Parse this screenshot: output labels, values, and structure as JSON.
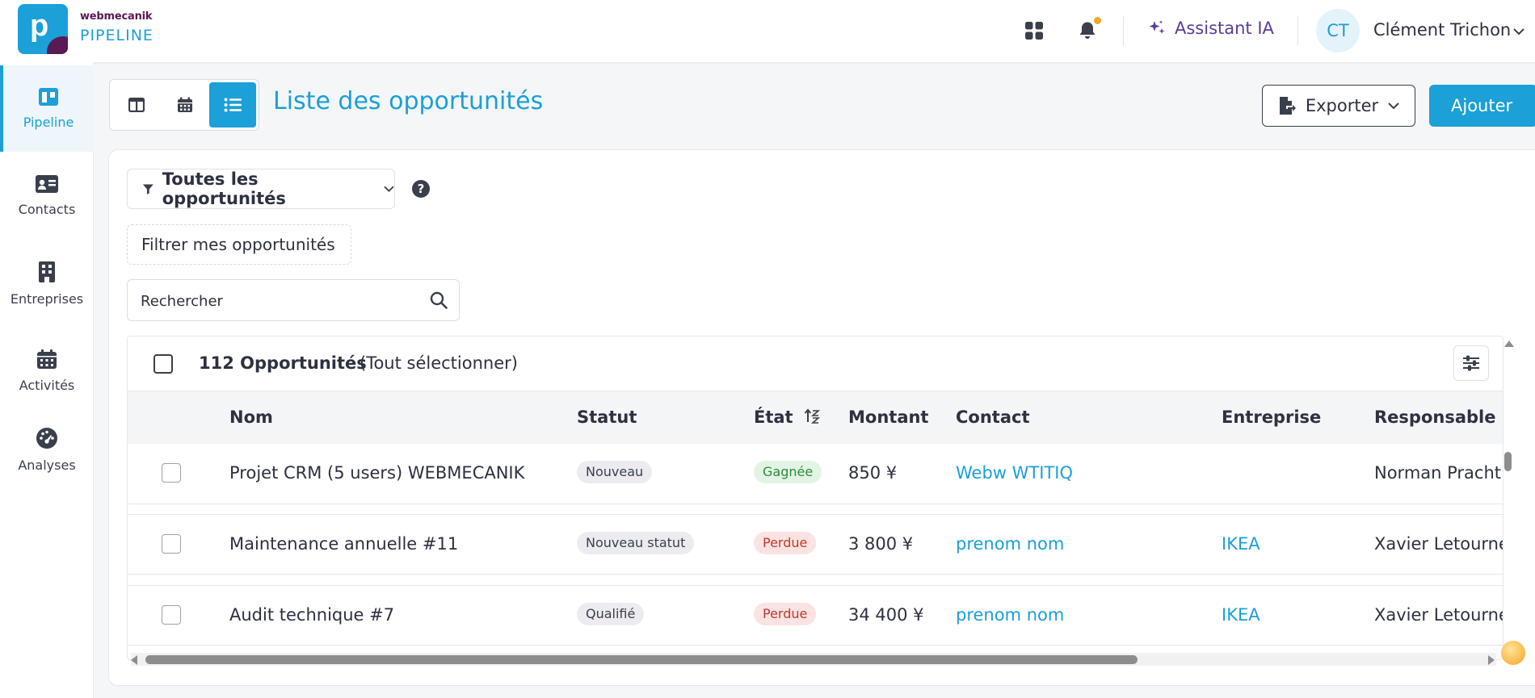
{
  "brand": {
    "company": "webmecanik",
    "product": "PIPELINE",
    "logo_letter": "p",
    "primary_color": "#1ba0d7",
    "secondary_color": "#5a1a54"
  },
  "header": {
    "assistant_label": "Assistant IA",
    "user_initials": "CT",
    "user_name": "Clément Trichon",
    "notification_dot_color": "#f5a623"
  },
  "sidebar": {
    "items": [
      {
        "label": "Pipeline",
        "icon": "columns-icon",
        "active": true
      },
      {
        "label": "Contacts",
        "icon": "contact-card-icon",
        "active": false
      },
      {
        "label": "Entreprises",
        "icon": "building-icon",
        "active": false
      },
      {
        "label": "Activités",
        "icon": "calendar-icon",
        "active": false
      },
      {
        "label": "Analyses",
        "icon": "gauge-icon",
        "active": false
      }
    ]
  },
  "page": {
    "title": "Liste des opportunités",
    "views": [
      "kanban-view",
      "calendar-view",
      "list-view"
    ],
    "active_view": "list-view",
    "export_label": "Exporter",
    "add_label": "Ajouter"
  },
  "filters": {
    "dropdown_label": "Toutes les opportunités",
    "help_symbol": "?",
    "my_filter_label": "Filtrer mes opportunités",
    "search_placeholder": "Rechercher"
  },
  "table": {
    "count_label": "112 Opportunités",
    "select_all_label": "(Tout sélectionner)",
    "columns": {
      "nom": "Nom",
      "statut": "Statut",
      "etat": "État",
      "montant": "Montant",
      "contact": "Contact",
      "entreprise": "Entreprise",
      "responsable": "Responsable"
    },
    "rows": [
      {
        "nom": "Projet CRM (5 users) WEBMECANIK",
        "statut": "Nouveau",
        "etat": "Gagnée",
        "montant": "850 ¥",
        "contact": "Webw WTITIQ",
        "entreprise": "",
        "responsable": "Norman Pracht"
      },
      {
        "nom": "Maintenance annuelle #11",
        "statut": "Nouveau statut",
        "etat": "Perdue",
        "montant": "3 800 ¥",
        "contact": "prenom nom",
        "entreprise": "IKEA",
        "responsable": "Xavier Letourne"
      },
      {
        "nom": "Audit technique #7",
        "statut": "Qualifié",
        "etat": "Perdue",
        "montant": "34 400 ¥",
        "contact": "prenom nom",
        "entreprise": "IKEA",
        "responsable": "Xavier Letourne"
      }
    ]
  }
}
